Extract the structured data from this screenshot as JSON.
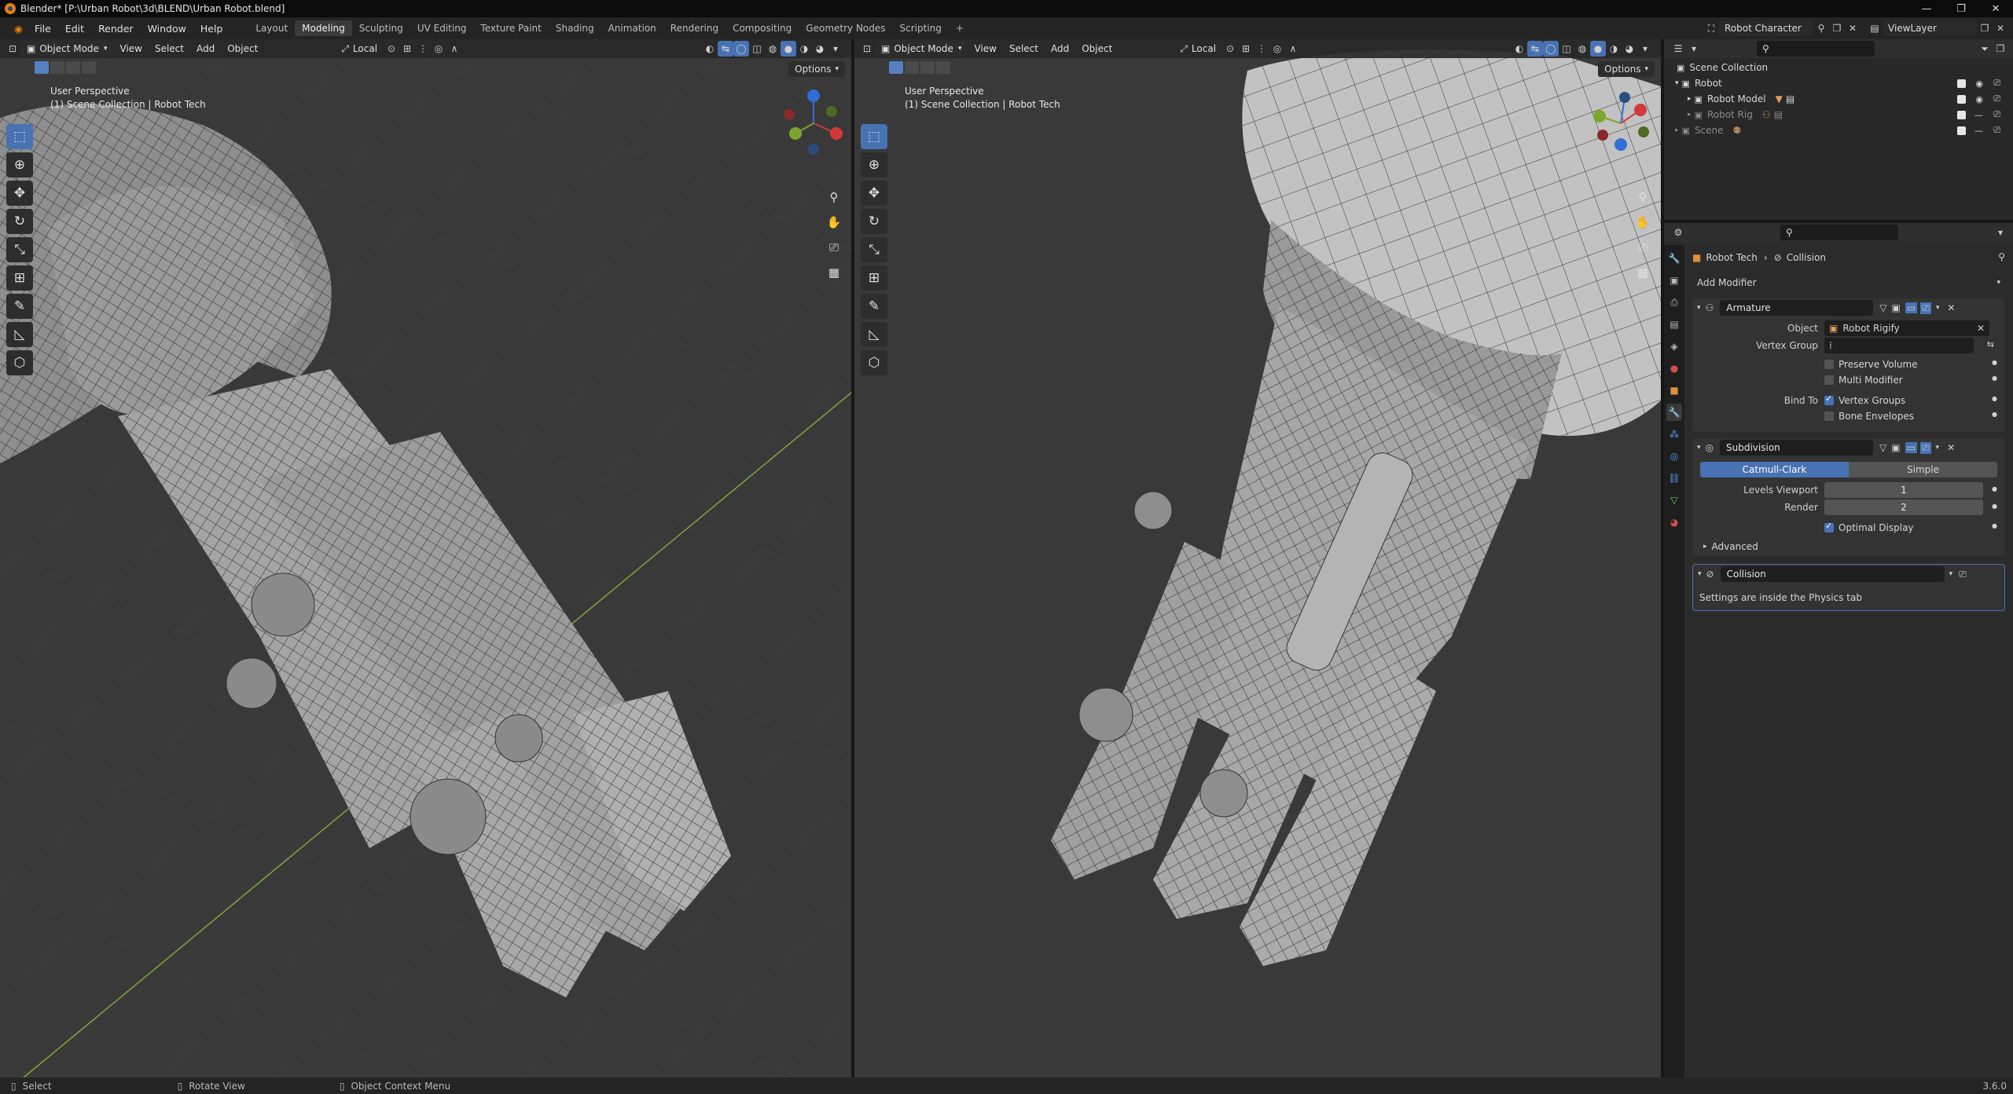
{
  "window": {
    "title": "Blender* [P:\\Urban Robot\\3d\\BLEND\\Urban Robot.blend]",
    "controls": [
      "—",
      "❐",
      "✕"
    ]
  },
  "menu": [
    "File",
    "Edit",
    "Render",
    "Window",
    "Help"
  ],
  "workspaces": [
    "Layout",
    "Modeling",
    "Sculpting",
    "UV Editing",
    "Texture Paint",
    "Shading",
    "Animation",
    "Rendering",
    "Compositing",
    "Geometry Nodes",
    "Scripting"
  ],
  "active_workspace": "Modeling",
  "scene": {
    "name": "Robot Character",
    "view_layer": "ViewLayer"
  },
  "viewport_left": {
    "mode": "Object Mode",
    "menus": [
      "View",
      "Select",
      "Add",
      "Object"
    ],
    "orientation": "Local",
    "options_label": "Options",
    "perspective": "User Perspective",
    "collection_info": "(1) Scene Collection | Robot Tech"
  },
  "viewport_right": {
    "mode": "Object Mode",
    "menus": [
      "View",
      "Select",
      "Add",
      "Object"
    ],
    "orientation": "Local",
    "options_label": "Options",
    "perspective": "User Perspective",
    "collection_info": "(1) Scene Collection | Robot Tech"
  },
  "outliner": {
    "rows": [
      {
        "label": "Scene Collection",
        "indent": 0
      },
      {
        "label": "Robot",
        "indent": 1
      },
      {
        "label": "Robot Model",
        "indent": 2
      },
      {
        "label": "Robot Rig",
        "indent": 2
      },
      {
        "label": "Scene",
        "indent": 1
      }
    ]
  },
  "properties": {
    "breadcrumb_object": "Robot Tech",
    "breadcrumb_modifier": "Collision",
    "add_modifier_label": "Add Modifier",
    "armature": {
      "name": "Armature",
      "object_label": "Object",
      "object_value": "Robot Rigify",
      "vertex_group_label": "Vertex Group",
      "preserve_volume": "Preserve Volume",
      "multi_modifier": "Multi Modifier",
      "bind_to_label": "Bind To",
      "vertex_groups": "Vertex Groups",
      "bone_envelopes": "Bone Envelopes"
    },
    "subdivision": {
      "name": "Subdivision",
      "catmull_clark": "Catmull-Clark",
      "simple": "Simple",
      "levels_viewport_label": "Levels Viewport",
      "levels_viewport": "1",
      "render_label": "Render",
      "render": "2",
      "optimal_display": "Optimal Display",
      "advanced": "Advanced"
    },
    "collision": {
      "name": "Collision",
      "note": "Settings are inside the Physics tab"
    }
  },
  "status": {
    "select": "Select",
    "rotate": "Rotate View",
    "context": "Object Context Menu",
    "version": "3.6.0"
  },
  "colors": {
    "accent": "#4772b3",
    "viewport": "#393939",
    "grid_axis": "#7fa63a"
  }
}
